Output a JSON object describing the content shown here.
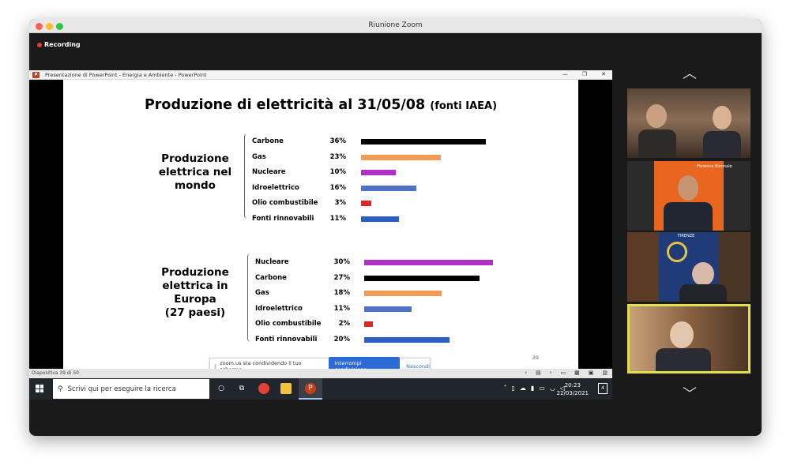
{
  "window": {
    "title": "Riunione Zoom"
  },
  "recording": {
    "label": "Recording"
  },
  "powerpoint": {
    "window_title": "Presentazione di PowerPoint  -  Energia e Ambiente - PowerPoint",
    "controls": [
      "—",
      "❐",
      "✕"
    ],
    "status_left": "Diapositiva 39 di 50"
  },
  "slide": {
    "title": "Produzione di elettricità al 31/05/08",
    "title_suffix": "(fonti IAEA)",
    "number": "39",
    "groups": [
      {
        "label": "Produzione elettrica nel mondo",
        "rows": [
          {
            "source": "Carbone",
            "pct": "36%",
            "value": 36,
            "color": "#000000"
          },
          {
            "source": "Gas",
            "pct": "23%",
            "value": 23,
            "color": "#f39b55"
          },
          {
            "source": "Nucleare",
            "pct": "10%",
            "value": 10,
            "color": "#b030c8"
          },
          {
            "source": "Idroelettrico",
            "pct": "16%",
            "value": 16,
            "color": "#4f72c4"
          },
          {
            "source": "Olio combustibile",
            "pct": "3%",
            "value": 3,
            "color": "#e02424"
          },
          {
            "source": "Fonti rinnovabili",
            "pct": "11%",
            "value": 11,
            "color": "#2a5fc4"
          }
        ]
      },
      {
        "label": "Produzione elettrica in Europa (27 paesi)",
        "rows": [
          {
            "source": "Nucleare",
            "pct": "30%",
            "value": 30,
            "color": "#b030c8"
          },
          {
            "source": "Carbone",
            "pct": "27%",
            "value": 27,
            "color": "#000000"
          },
          {
            "source": "Gas",
            "pct": "18%",
            "value": 18,
            "color": "#f39b55"
          },
          {
            "source": "Idroelettrico",
            "pct": "11%",
            "value": 11,
            "color": "#4f72c4"
          },
          {
            "source": "Olio combustibile",
            "pct": "2%",
            "value": 2,
            "color": "#e02424"
          },
          {
            "source": "Fonti rinnovabili",
            "pct": "20%",
            "value": 20,
            "color": "#2a5fc4"
          }
        ]
      }
    ]
  },
  "share_toolbar": {
    "message": "zoom.us sta condividendo il tuo schermo.",
    "stop_label": "Interrompi condivisione",
    "hide_label": "Nascondi"
  },
  "taskbar": {
    "search_placeholder": "Scrivi qui per eseguire la ricerca",
    "time": "20:23",
    "date": "22/03/2021",
    "notifications": "4"
  },
  "gallery": {
    "tiles": [
      {
        "name": "participant-1"
      },
      {
        "name": "participant-2",
        "label": "Florence Biennale"
      },
      {
        "name": "participant-3",
        "label": "FIRENZE"
      },
      {
        "name": "participant-4",
        "active": true
      }
    ]
  }
}
